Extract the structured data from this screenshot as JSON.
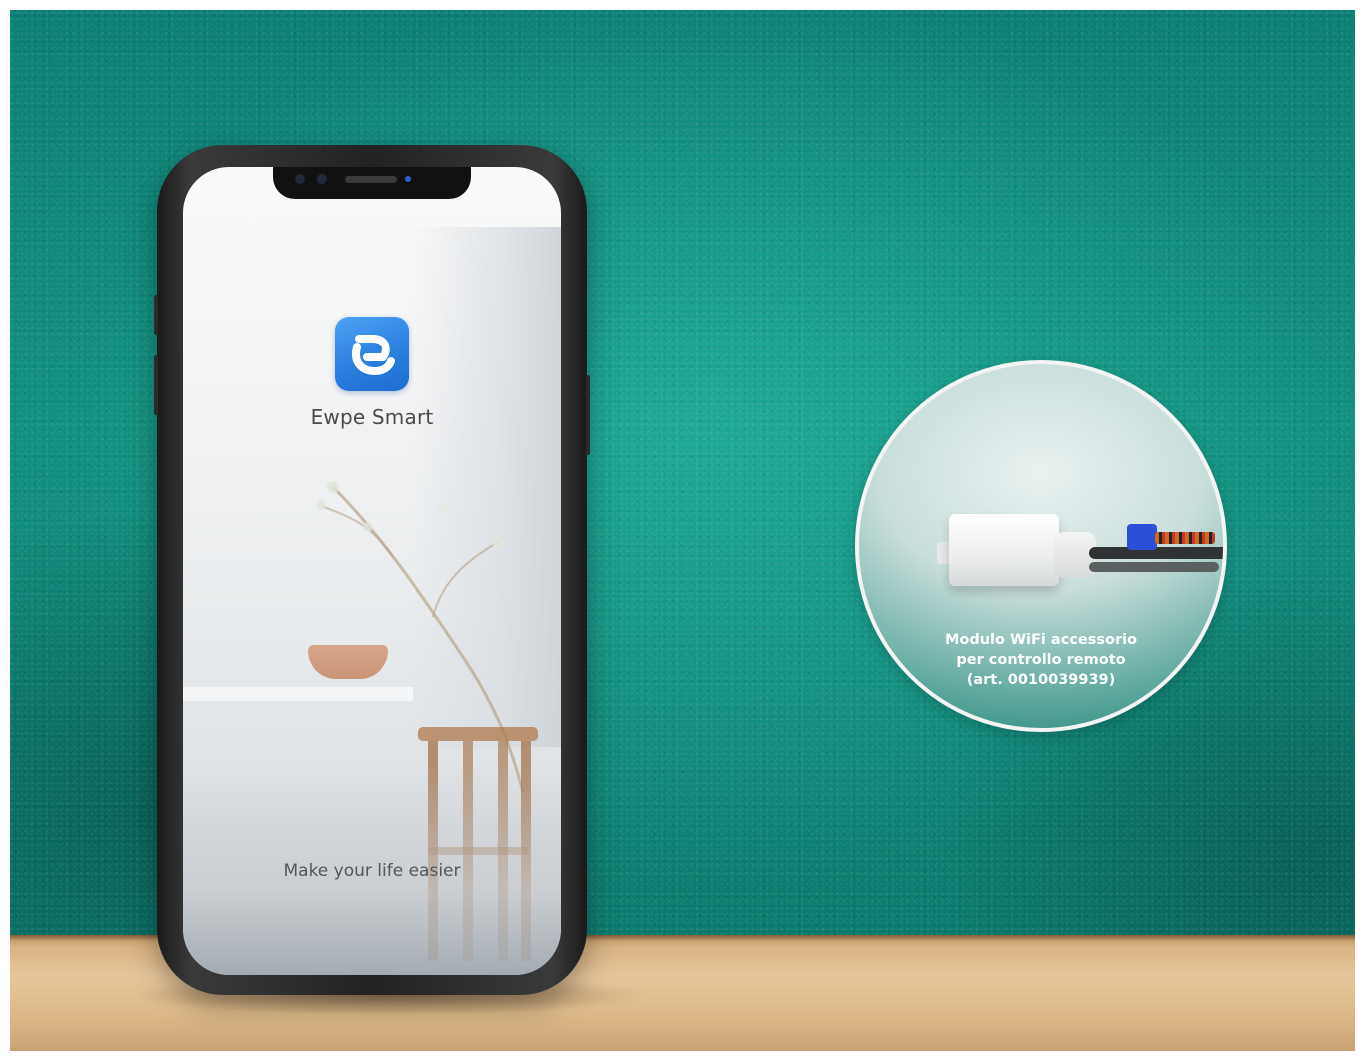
{
  "phone_screen": {
    "app_name": "Ewpe Smart",
    "tagline": "Make your life easier"
  },
  "inset": {
    "caption_line1": "Modulo WiFi accessorio",
    "caption_line2": "per controllo remoto",
    "caption_line3": "(art. 0010039939)"
  },
  "colors": {
    "wall": "#0f8a7c",
    "app_icon": "#2a7fe0",
    "connector": "#2b4fd6"
  },
  "icons": [
    "ewpe-smart-app-icon"
  ]
}
